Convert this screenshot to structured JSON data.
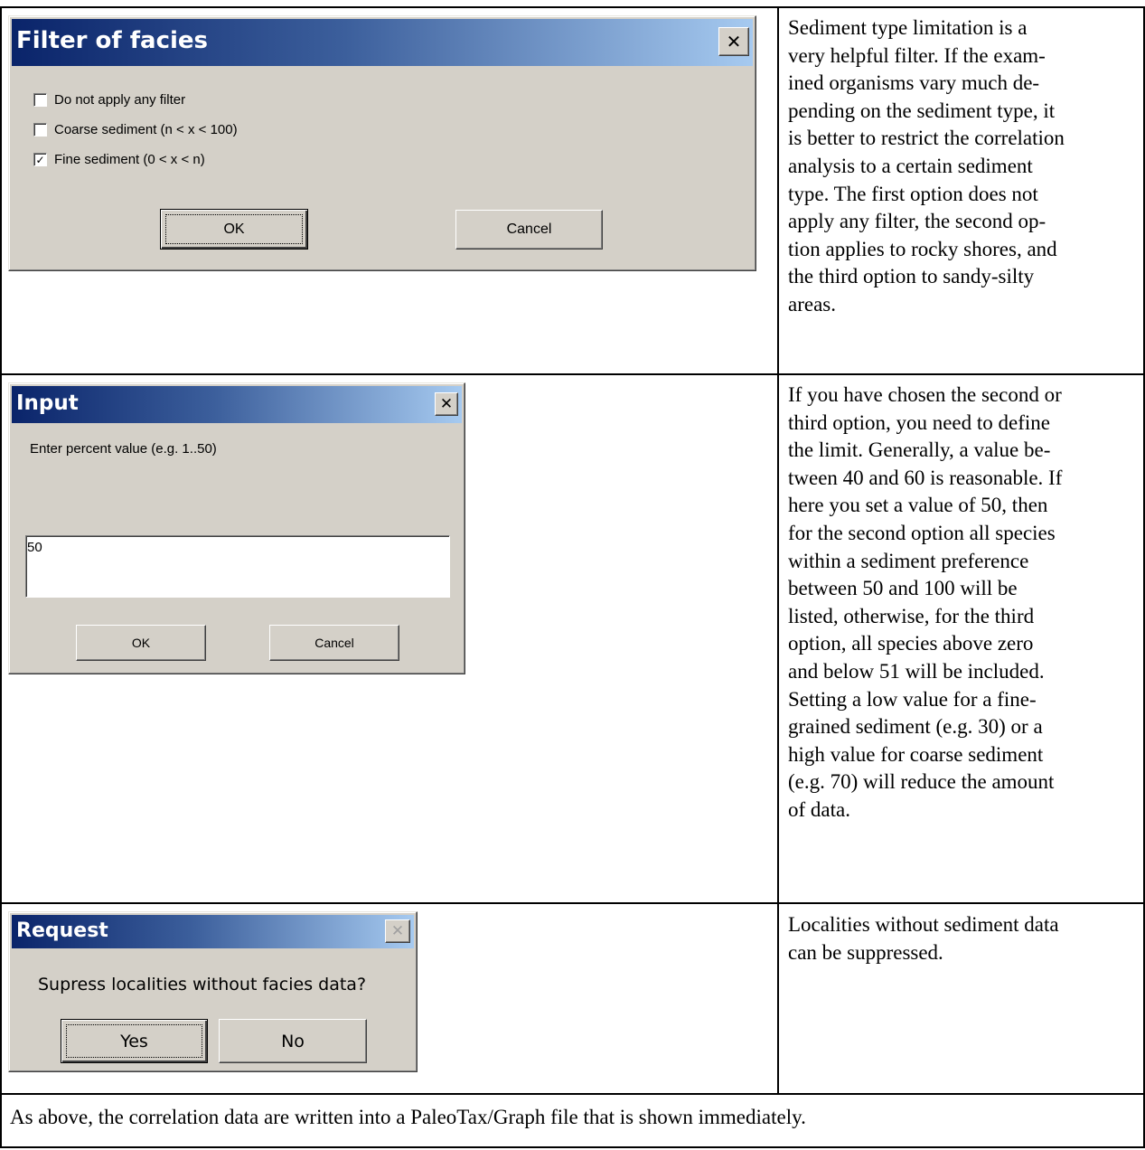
{
  "rows": {
    "facies": {
      "dialog": {
        "title": "Filter of facies",
        "close_glyph": "✕",
        "close_icon": "close-icon",
        "options": [
          {
            "label": "Do not apply any filter",
            "checked": false
          },
          {
            "label": "Coarse sediment (n < x < 100)",
            "checked": false
          },
          {
            "label": "Fine sediment (0 < x < n)",
            "checked": true
          }
        ],
        "check_glyph": "✓",
        "ok_label": "OK",
        "cancel_label": "Cancel"
      },
      "description": [
        "Sediment type limitation is a",
        "very helpful filter. If the exam-",
        "ined organisms vary much de-",
        "pending on the sediment type, it",
        "is better to restrict the correlation",
        "analysis to a certain sediment",
        "type. The first option does not",
        "apply any filter, the second op-",
        "tion applies to rocky shores, and",
        "the third option to sandy-silty",
        "areas."
      ]
    },
    "input": {
      "dialog": {
        "title": "Input",
        "close_glyph": "✕",
        "prompt": "Enter percent value (e.g. 1..50)",
        "value": "50",
        "ok_label": "OK",
        "cancel_label": "Cancel"
      },
      "description": [
        "If you have chosen the second or",
        "third option, you need to define",
        "the limit. Generally, a value be-",
        "tween 40 and 60 is reasonable. If",
        "here you set a value of 50, then",
        "for the second option all species",
        "within a sediment preference",
        "between 50 and 100 will be",
        "listed, otherwise, for the third",
        "option, all species above zero",
        "and below 51 will be included.",
        "Setting a low value for a fine-",
        "grained sediment (e.g. 30) or a",
        "high value for coarse sediment",
        "(e.g. 70) will reduce the amount",
        "of data."
      ]
    },
    "request": {
      "dialog": {
        "title": "Request",
        "close_glyph": "✕",
        "question": "Supress localities without facies data?",
        "yes_label": "Yes",
        "no_label": "No"
      },
      "description": [
        "Localities without sediment data",
        "can be suppressed."
      ]
    }
  },
  "footer": "As above, the correlation data are written into a PaleoTax/Graph file that is shown immediately."
}
